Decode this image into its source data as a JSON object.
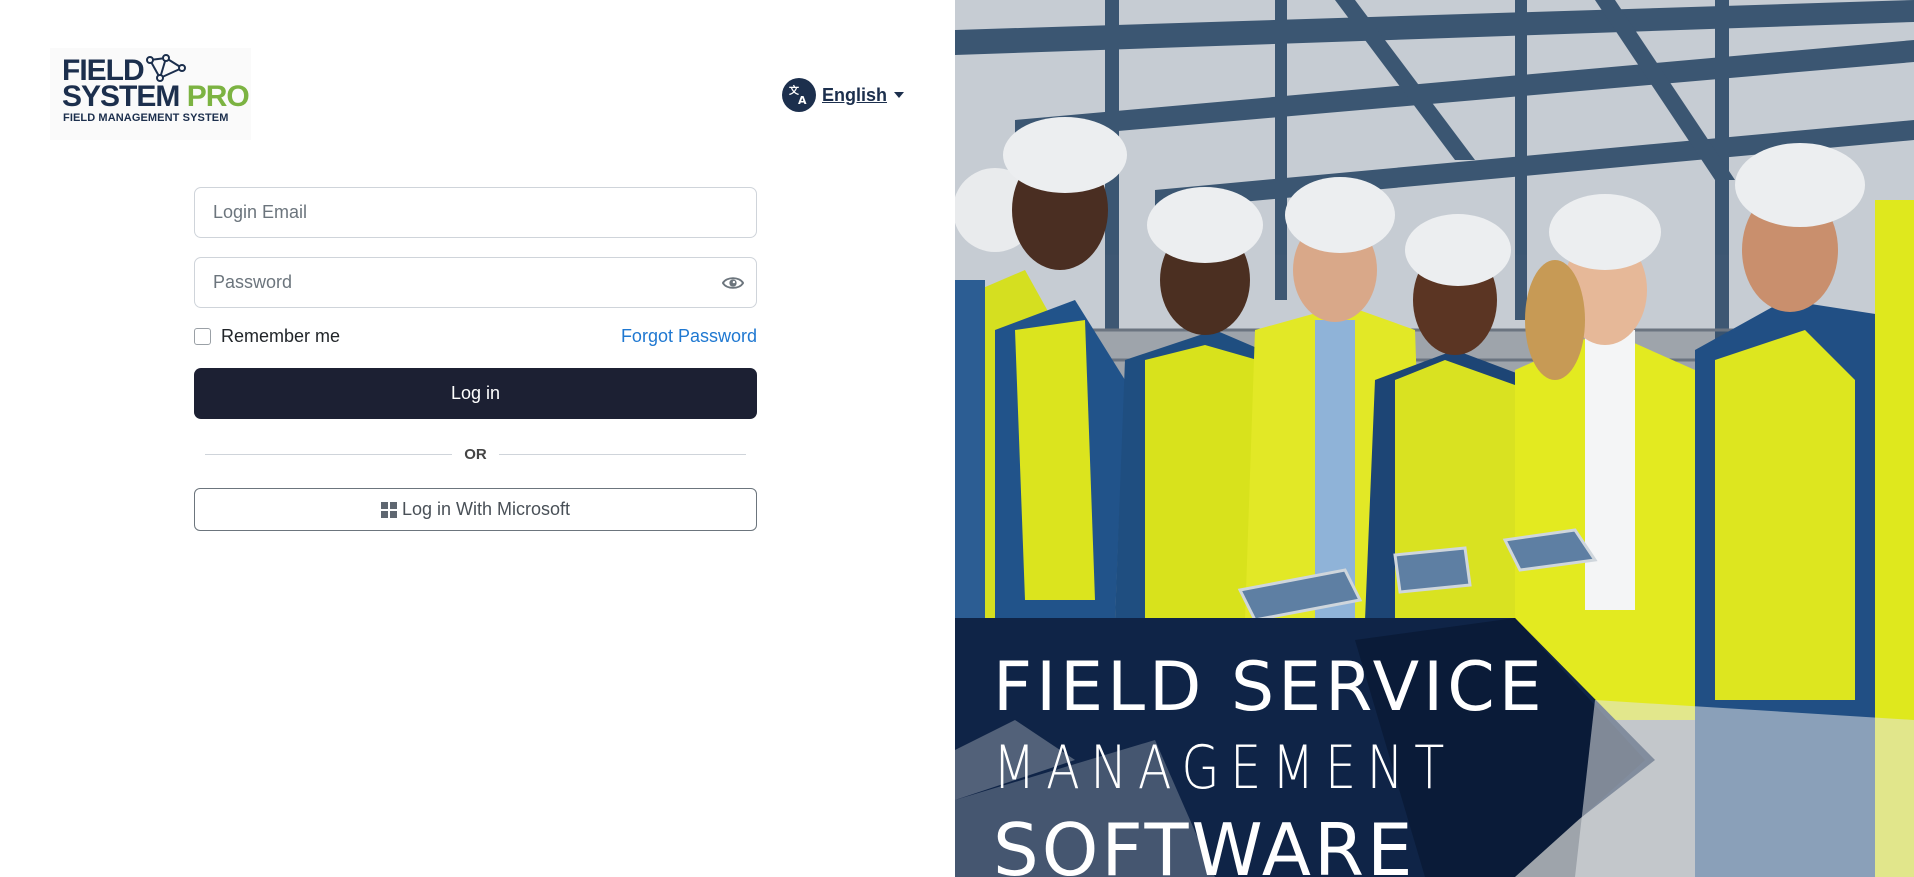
{
  "brand": {
    "line1": "FIELD",
    "line2_a": "SYSTEM ",
    "line2_b": "PRO",
    "tagline": "FIELD MANAGEMENT SYSTEM"
  },
  "language": {
    "selected": "English",
    "icon": "translate-icon"
  },
  "form": {
    "email_placeholder": "Login Email",
    "password_placeholder": "Password",
    "remember_label": "Remember me",
    "forgot_label": "Forgot Password",
    "login_label": "Log in",
    "or_label": "OR",
    "microsoft_label": "Log in With Microsoft"
  },
  "hero": {
    "line1": "FIELD SERVICE",
    "line2": "MANAGEMENT",
    "line3": "SOFTWARE"
  },
  "colors": {
    "primary": "#1c2033",
    "link": "#1f78d1",
    "brand_navy": "#1c2f4d",
    "brand_green": "#7cb342",
    "banner_navy": "#0f2447"
  }
}
